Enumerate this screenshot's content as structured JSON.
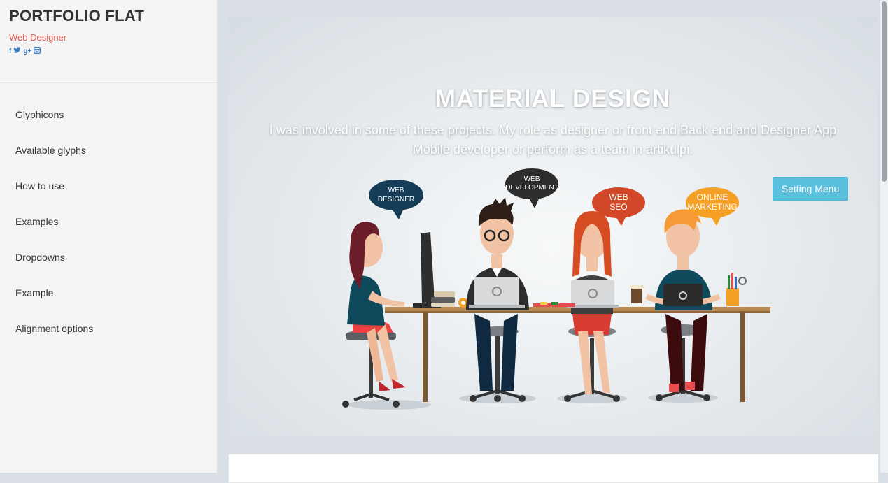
{
  "sidebar": {
    "title": "PORTFOLIO FLAT",
    "subtitle": "Web Designer",
    "social": [
      "f",
      "t",
      "g+",
      "ig"
    ],
    "items": [
      {
        "label": "Glyphicons"
      },
      {
        "label": "Available glyphs"
      },
      {
        "label": "How to use"
      },
      {
        "label": "Examples"
      },
      {
        "label": "Dropdowns"
      },
      {
        "label": "Example"
      },
      {
        "label": "Alignment options"
      }
    ]
  },
  "hero": {
    "title": "MATERIAL DESIGN",
    "text": "I was involved in some of these projects. My role as designer or front end,Back end and Designer App Mobile developer or perform as a team in artikulpi.",
    "button_label": "Setting Menu",
    "bubbles": {
      "b1": [
        "WEB",
        "DESIGNER"
      ],
      "b2": [
        "WEB",
        "DEVELOPMENT"
      ],
      "b3": [
        "WEB",
        "SEO"
      ],
      "b4": [
        "ONLINE",
        "MARKETING"
      ]
    }
  },
  "colors": {
    "accent": "#5bc0de",
    "subtitle": "#e05a4f",
    "social": "#3b7dc4",
    "bubble_navy": "#153d57",
    "bubble_dark": "#2d2d2d",
    "bubble_red": "#d24727",
    "bubble_orange": "#f4a025"
  }
}
